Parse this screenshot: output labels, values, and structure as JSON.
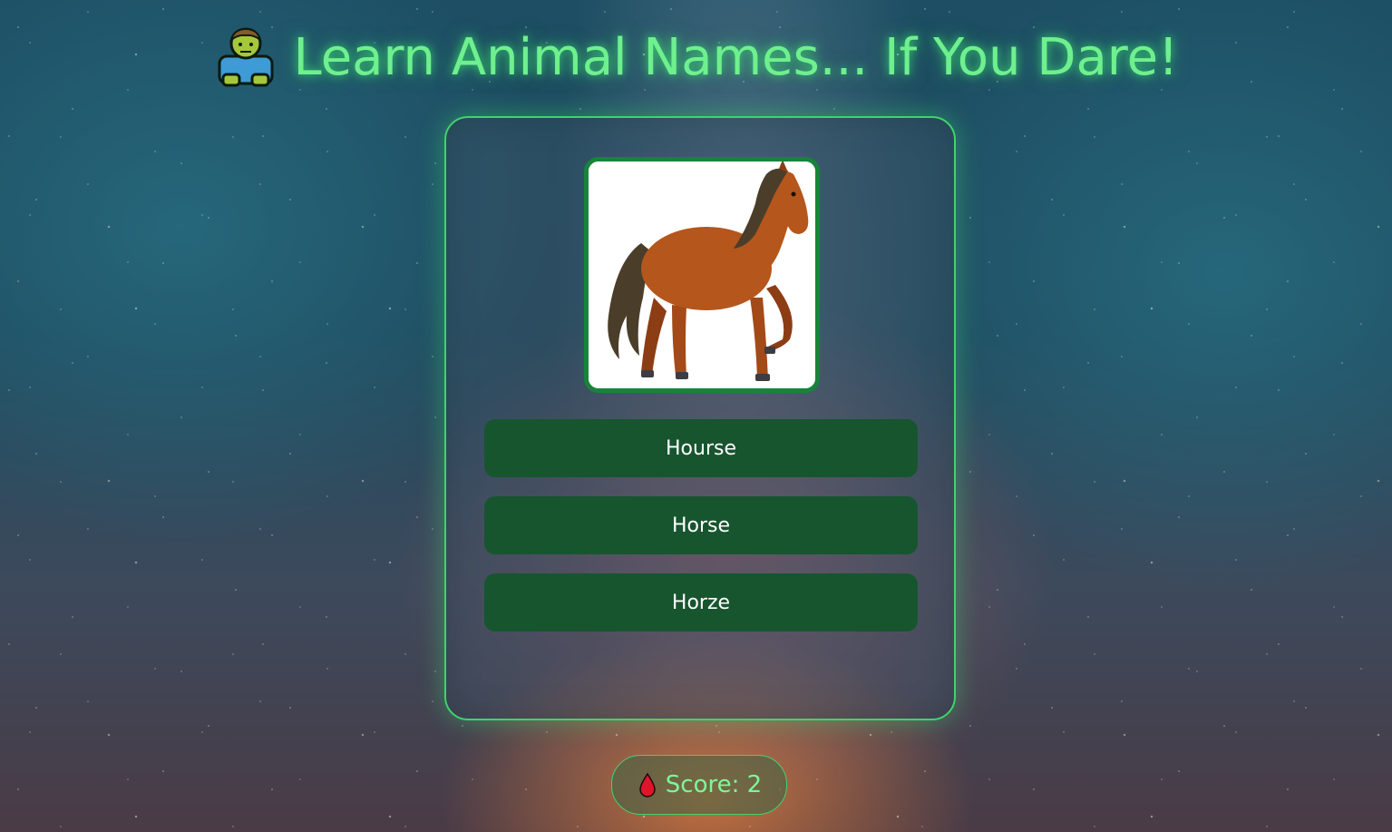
{
  "header": {
    "title": "Learn Animal Names... If You Dare!",
    "icon": "zombie-icon"
  },
  "quiz": {
    "image_subject": "horse",
    "options": [
      {
        "label": "Hourse"
      },
      {
        "label": "Horse"
      },
      {
        "label": "Horze"
      }
    ]
  },
  "score": {
    "icon": "blood-drop-icon",
    "label": "Score: 2"
  },
  "colors": {
    "accent_green": "#6ff08f",
    "button_bg": "#17552f",
    "frame_border": "#17843a",
    "card_border": "#3fd46a"
  }
}
